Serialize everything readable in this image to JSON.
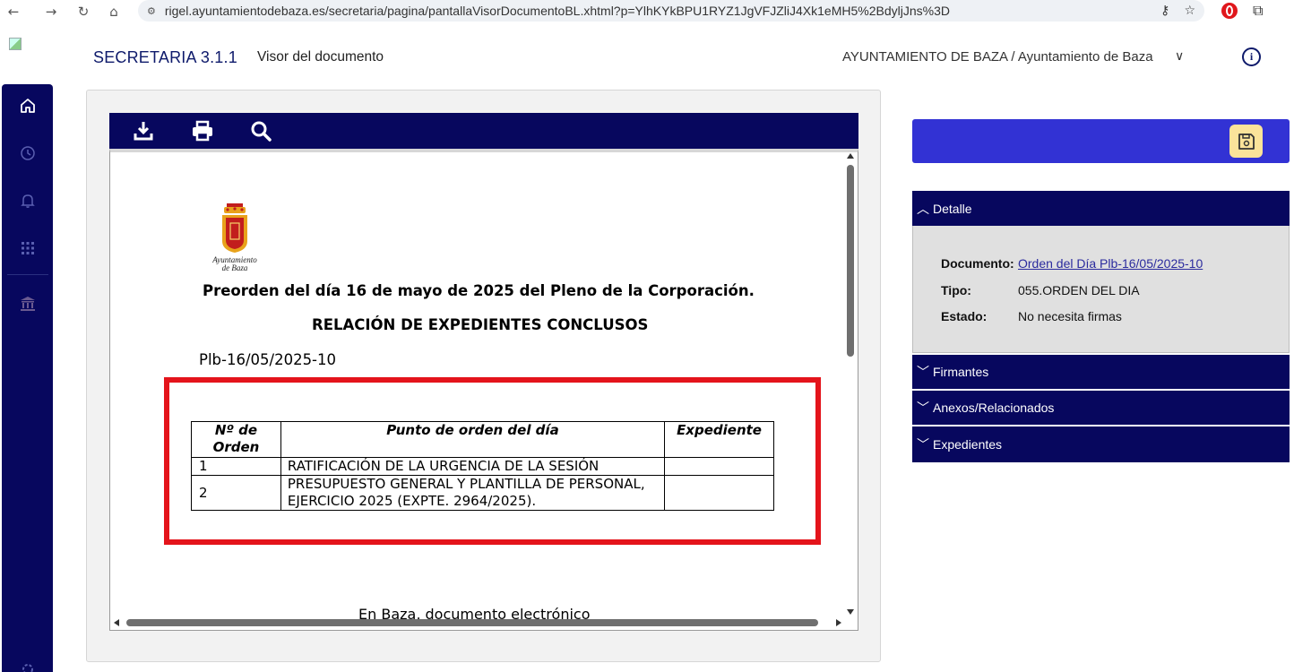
{
  "browser": {
    "url": "rigel.ayuntamientodebaza.es/secretaria/pagina/pantallaVisorDocumentoBL.xhtml?p=YlhKYkBPU1RYZ1JgVFJZliJ4Xk1eMH5%2BdyljJns%3D"
  },
  "header": {
    "app_title": "SECRETARIA 3.1.1",
    "page_title": "Visor del documento",
    "organization": "AYUNTAMIENTO DE BAZA / Ayuntamiento de Baza"
  },
  "document": {
    "logo_text_line1": "Ayuntamiento",
    "logo_text_line2": "de Baza",
    "heading": "Preorden del día 16 de mayo de 2025 del Pleno de la Corporación.",
    "subheading": "RELACIÓN DE EXPEDIENTES CONCLUSOS",
    "reference": "Plb-16/05/2025-10",
    "table": {
      "headers": [
        "Nº de Orden",
        "Punto de orden del día",
        "Expediente"
      ],
      "rows": [
        [
          "1",
          "RATIFICACIÓN DE LA URGENCIA DE LA SESIÓN",
          ""
        ],
        [
          "2",
          "PRESUPUESTO GENERAL Y PLANTILLA DE PERSONAL, EJERCICIO 2025 (EXPTE. 2964/2025).",
          ""
        ]
      ]
    },
    "footer_text": "En Baza, documento electrónico"
  },
  "panel": {
    "sections": {
      "detalle": "Detalle",
      "firmantes": "Firmantes",
      "anexos": "Anexos/Relacionados",
      "expedientes": "Expedientes"
    },
    "details": {
      "documento_label": "Documento:",
      "documento_value": "Orden del Día Plb-16/05/2025-10",
      "tipo_label": "Tipo:",
      "tipo_value": "055.ORDEN DEL DIA",
      "estado_label": "Estado:",
      "estado_value": "No necesita firmas"
    }
  },
  "colors": {
    "navy": "#07075e",
    "accent_blue": "#3232d4",
    "highlight_red": "#e4141b",
    "save_button": "#fbe39a"
  }
}
